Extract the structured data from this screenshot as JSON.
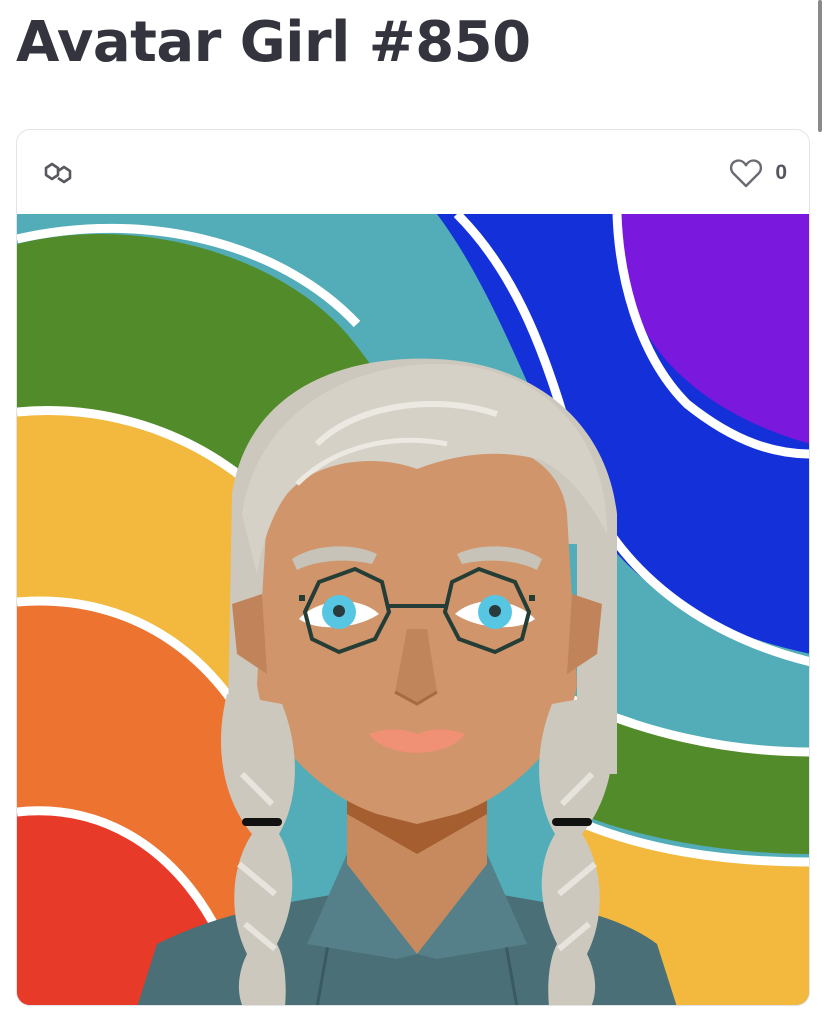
{
  "page": {
    "title": "Avatar Girl #850"
  },
  "card": {
    "chain_icon": "polygon-chain-icon",
    "like_icon": "heart-icon",
    "like_count": "0",
    "image": {
      "subject": "avatar-girl-portrait",
      "colors": {
        "teal": "#52adb8",
        "blue": "#1430d8",
        "purple": "#7b18de",
        "green": "#528c2a",
        "yellow": "#f2b93e",
        "orange": "#ec7330",
        "red": "#e83a28",
        "hair": "#cdc8bd",
        "skin": "#d0956a",
        "shirt": "#4a6f76",
        "lips": "#f09175",
        "eyes": "#57c6e3"
      }
    }
  }
}
